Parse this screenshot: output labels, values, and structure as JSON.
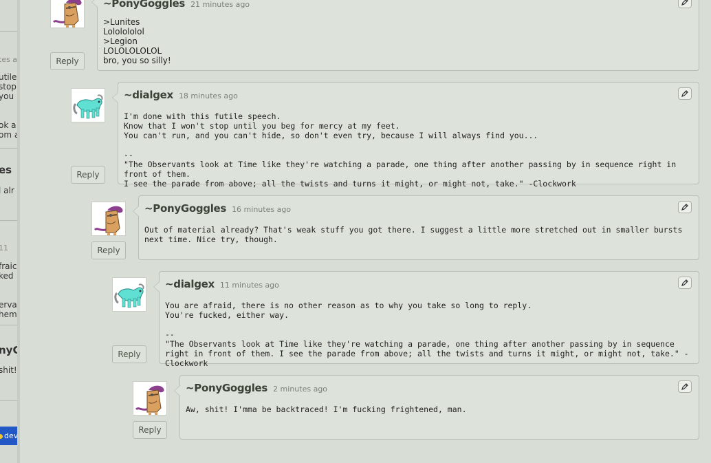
{
  "left_column": {
    "fragments": [
      "tes a",
      "utile",
      "stop",
      "you",
      "ok a",
      "om a",
      "es",
      "l alr",
      "11",
      "fraic",
      "ked",
      "erva",
      "hem.",
      "nyG",
      "shit!"
    ],
    "dev_tab_label": "dev"
  },
  "edit_icon": "pencil-icon",
  "comments": [
    {
      "author": "~PonyGoggles",
      "time": "21 minutes ago",
      "body": ">Lunites\nLololololol\n>Legion\nLOLOLOLOLOL\nbro, you so silly!",
      "reply_label": "Reply"
    },
    {
      "author": "~dialgex",
      "time": "18 minutes ago",
      "body": "I'm done with this futile speech.\nKnow that I won't stop until you beg for mercy at my feet.\nYou can't run, and you can't hide, so don't even try, because I will always find you...\n\n--\n\"The Observants look at Time like they're watching a parade, one thing after another passing by in sequence right in front of them.\nI see the parade from above; all the twists and turns it might, or might not, take.\" -Clockwork",
      "reply_label": "Reply"
    },
    {
      "author": "~PonyGoggles",
      "time": "16 minutes ago",
      "body": "Out of material already? That's weak stuff you got there. I suggest a little more stretched out in smaller bursts next time. Nice try, though.",
      "reply_label": "Reply"
    },
    {
      "author": "~dialgex",
      "time": "11 minutes ago",
      "body": "You are afraid, there is no other reason as to why you take so long to reply.\nYou're fucked, either way.\n\n--\n\"The Observants look at Time like they're watching a parade, one thing after another passing by in sequence right in front of them. I see the parade from above; all the twists and turns it might, or might not, take.\" -Clockwork",
      "reply_label": "Reply"
    },
    {
      "author": "~PonyGoggles",
      "time": "2 minutes ago",
      "body": "Aw, shit! I'mma be backtraced! I'm fucking frightened, man.",
      "reply_label": "Reply"
    }
  ]
}
